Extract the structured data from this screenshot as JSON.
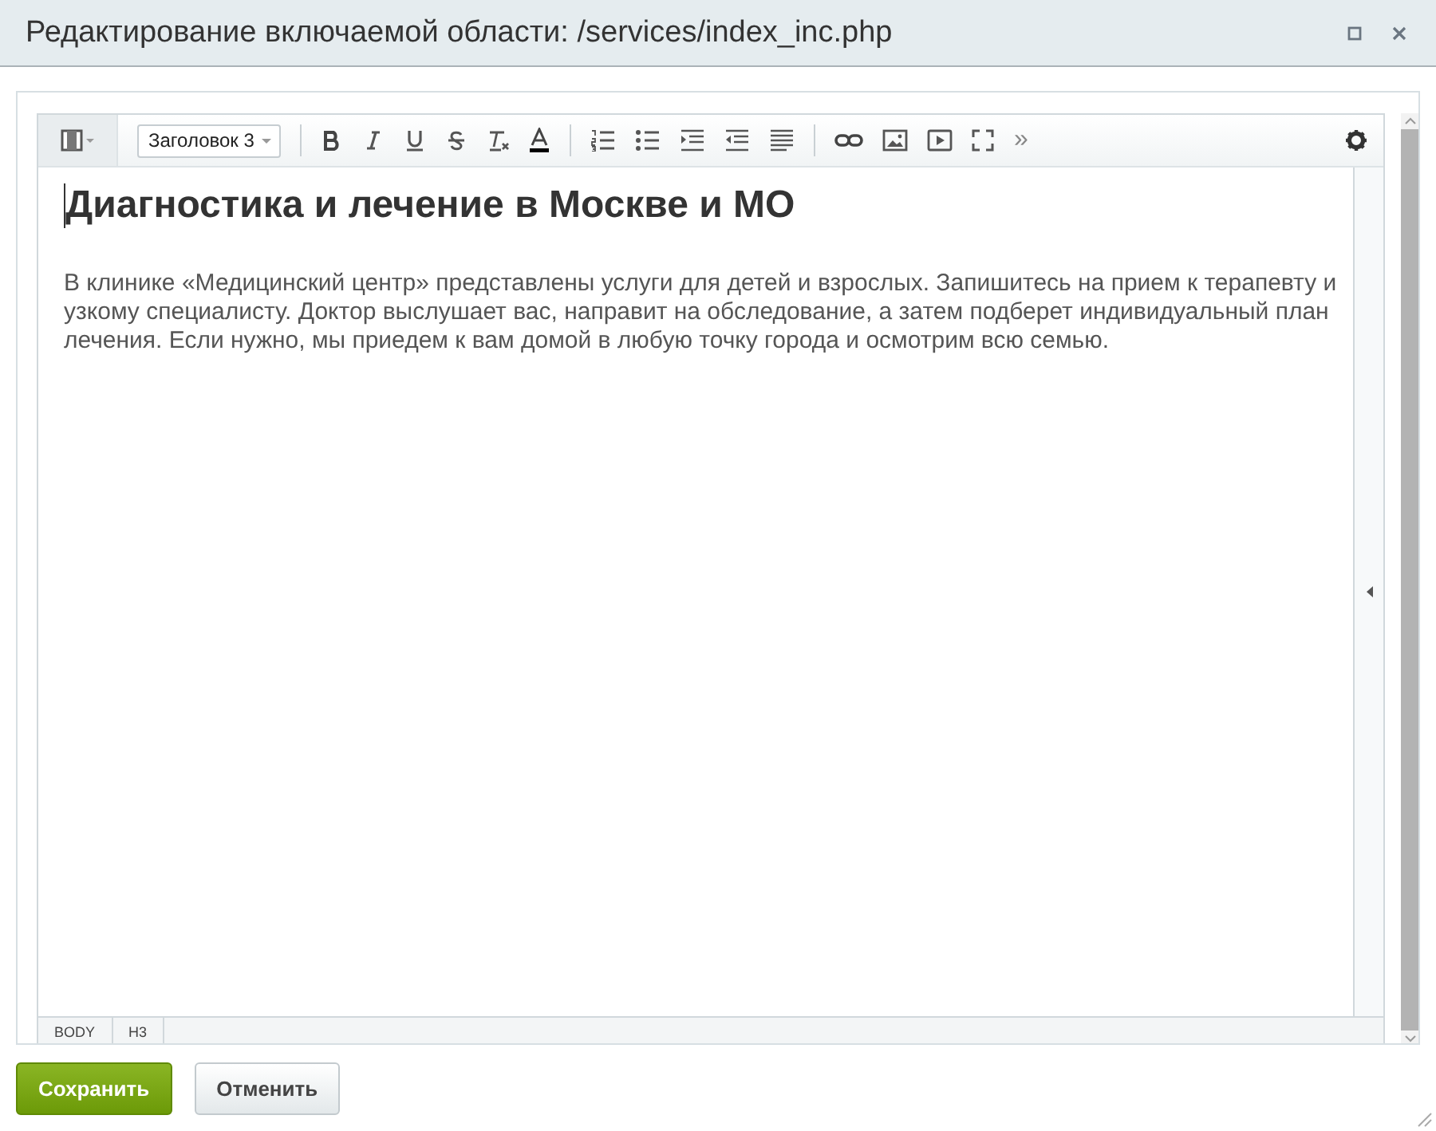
{
  "window": {
    "title": "Редактирование включаемой области: /services/index_inc.php"
  },
  "toolbar": {
    "style_select": "Заголовок 3",
    "more": "»"
  },
  "content": {
    "heading": "Диагностика и лечение в Москве и МО",
    "paragraph": "В клинике «Медицинский центр» представлены услуги для детей и взрослых. Запишитесь на прием к терапевту и узкому специалисту. Доктор выслушает вас, направит на обследование, а затем подберет индивидуальный план лечения. Если нужно, мы приедем к вам домой в любую точку города и осмотрим всю семью."
  },
  "status_bar": {
    "path": [
      "BODY",
      "H3"
    ]
  },
  "buttons": [
    {
      "label": "Сохранить",
      "kind": "primary"
    },
    {
      "label": "Отменить",
      "kind": "secondary"
    }
  ]
}
